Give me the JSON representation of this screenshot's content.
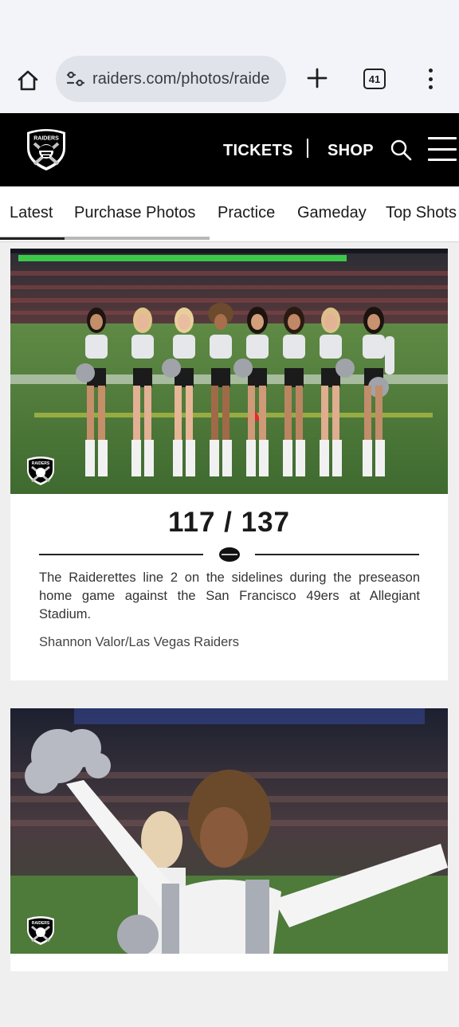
{
  "browser": {
    "url": "raiders.com/photos/raide",
    "tab_count": "41",
    "icons": [
      "home-icon",
      "site-settings-icon",
      "new-tab-plus-icon",
      "tab-switcher-icon",
      "overflow-menu-icon"
    ]
  },
  "header": {
    "logo_text": "RAIDERS",
    "tickets_label": "TICKETS",
    "shop_label": "SHOP",
    "icons": [
      "raiders-shield-logo",
      "search-icon",
      "hamburger-menu-icon"
    ],
    "background": "#000000"
  },
  "category_tabs": [
    {
      "label": "Latest",
      "active": true
    },
    {
      "label": "Purchase Photos",
      "active": false
    },
    {
      "label": "Practice",
      "active": false
    },
    {
      "label": "Gameday",
      "active": false
    },
    {
      "label": "Top Shots",
      "active": false
    }
  ],
  "gallery": {
    "current": {
      "counter": "117 / 137",
      "caption": "The Raiderettes line 2 on the sidelines during the preseason home game against the San Francisco 49ers at Allegiant Stadium.",
      "credit": "Shannon Valor/Las Vegas Raiders",
      "watermark": "RAIDERS"
    },
    "next": {
      "watermark": "RAIDERS"
    }
  },
  "colors": {
    "silver": "#c4c4c4",
    "black": "#000000",
    "field_green": "#4e7a3a"
  }
}
